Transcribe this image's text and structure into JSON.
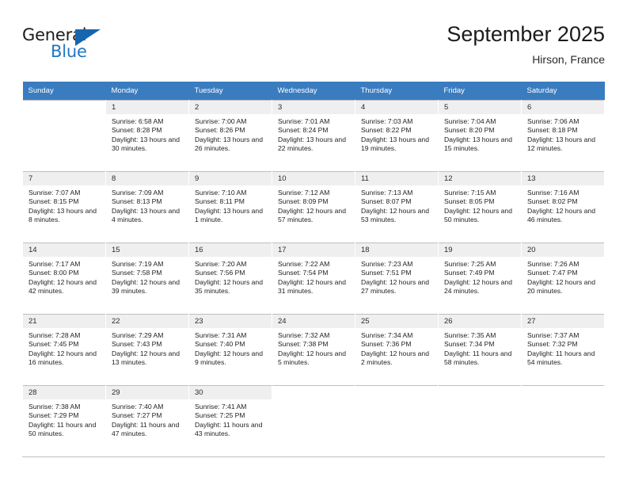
{
  "brand": {
    "name_top": "General",
    "name_bottom": "Blue",
    "triangle_icon": "triangle-icon",
    "color_dark": "#1b1b1b",
    "color_blue": "#2077c4",
    "color_triangle": "#1566ae"
  },
  "header": {
    "title": "September 2025",
    "subtitle": "Hirson, France"
  },
  "colors": {
    "header_row": "#3a7cc0",
    "header_text": "#ffffff",
    "daynum_band": "#efefef",
    "grid_line": "#bfbfbf"
  },
  "weekday_headers": [
    "Sunday",
    "Monday",
    "Tuesday",
    "Wednesday",
    "Thursday",
    "Friday",
    "Saturday"
  ],
  "weeks": [
    [
      {
        "day": "",
        "sunrise": "",
        "sunset": "",
        "daylight": "",
        "empty": true
      },
      {
        "day": "1",
        "sunrise": "Sunrise: 6:58 AM",
        "sunset": "Sunset: 8:28 PM",
        "daylight": "Daylight: 13 hours and 30 minutes."
      },
      {
        "day": "2",
        "sunrise": "Sunrise: 7:00 AM",
        "sunset": "Sunset: 8:26 PM",
        "daylight": "Daylight: 13 hours and 26 minutes."
      },
      {
        "day": "3",
        "sunrise": "Sunrise: 7:01 AM",
        "sunset": "Sunset: 8:24 PM",
        "daylight": "Daylight: 13 hours and 22 minutes."
      },
      {
        "day": "4",
        "sunrise": "Sunrise: 7:03 AM",
        "sunset": "Sunset: 8:22 PM",
        "daylight": "Daylight: 13 hours and 19 minutes."
      },
      {
        "day": "5",
        "sunrise": "Sunrise: 7:04 AM",
        "sunset": "Sunset: 8:20 PM",
        "daylight": "Daylight: 13 hours and 15 minutes."
      },
      {
        "day": "6",
        "sunrise": "Sunrise: 7:06 AM",
        "sunset": "Sunset: 8:18 PM",
        "daylight": "Daylight: 13 hours and 12 minutes."
      }
    ],
    [
      {
        "day": "7",
        "sunrise": "Sunrise: 7:07 AM",
        "sunset": "Sunset: 8:15 PM",
        "daylight": "Daylight: 13 hours and 8 minutes."
      },
      {
        "day": "8",
        "sunrise": "Sunrise: 7:09 AM",
        "sunset": "Sunset: 8:13 PM",
        "daylight": "Daylight: 13 hours and 4 minutes."
      },
      {
        "day": "9",
        "sunrise": "Sunrise: 7:10 AM",
        "sunset": "Sunset: 8:11 PM",
        "daylight": "Daylight: 13 hours and 1 minute."
      },
      {
        "day": "10",
        "sunrise": "Sunrise: 7:12 AM",
        "sunset": "Sunset: 8:09 PM",
        "daylight": "Daylight: 12 hours and 57 minutes."
      },
      {
        "day": "11",
        "sunrise": "Sunrise: 7:13 AM",
        "sunset": "Sunset: 8:07 PM",
        "daylight": "Daylight: 12 hours and 53 minutes."
      },
      {
        "day": "12",
        "sunrise": "Sunrise: 7:15 AM",
        "sunset": "Sunset: 8:05 PM",
        "daylight": "Daylight: 12 hours and 50 minutes."
      },
      {
        "day": "13",
        "sunrise": "Sunrise: 7:16 AM",
        "sunset": "Sunset: 8:02 PM",
        "daylight": "Daylight: 12 hours and 46 minutes."
      }
    ],
    [
      {
        "day": "14",
        "sunrise": "Sunrise: 7:17 AM",
        "sunset": "Sunset: 8:00 PM",
        "daylight": "Daylight: 12 hours and 42 minutes."
      },
      {
        "day": "15",
        "sunrise": "Sunrise: 7:19 AM",
        "sunset": "Sunset: 7:58 PM",
        "daylight": "Daylight: 12 hours and 39 minutes."
      },
      {
        "day": "16",
        "sunrise": "Sunrise: 7:20 AM",
        "sunset": "Sunset: 7:56 PM",
        "daylight": "Daylight: 12 hours and 35 minutes."
      },
      {
        "day": "17",
        "sunrise": "Sunrise: 7:22 AM",
        "sunset": "Sunset: 7:54 PM",
        "daylight": "Daylight: 12 hours and 31 minutes."
      },
      {
        "day": "18",
        "sunrise": "Sunrise: 7:23 AM",
        "sunset": "Sunset: 7:51 PM",
        "daylight": "Daylight: 12 hours and 27 minutes."
      },
      {
        "day": "19",
        "sunrise": "Sunrise: 7:25 AM",
        "sunset": "Sunset: 7:49 PM",
        "daylight": "Daylight: 12 hours and 24 minutes."
      },
      {
        "day": "20",
        "sunrise": "Sunrise: 7:26 AM",
        "sunset": "Sunset: 7:47 PM",
        "daylight": "Daylight: 12 hours and 20 minutes."
      }
    ],
    [
      {
        "day": "21",
        "sunrise": "Sunrise: 7:28 AM",
        "sunset": "Sunset: 7:45 PM",
        "daylight": "Daylight: 12 hours and 16 minutes."
      },
      {
        "day": "22",
        "sunrise": "Sunrise: 7:29 AM",
        "sunset": "Sunset: 7:43 PM",
        "daylight": "Daylight: 12 hours and 13 minutes."
      },
      {
        "day": "23",
        "sunrise": "Sunrise: 7:31 AM",
        "sunset": "Sunset: 7:40 PM",
        "daylight": "Daylight: 12 hours and 9 minutes."
      },
      {
        "day": "24",
        "sunrise": "Sunrise: 7:32 AM",
        "sunset": "Sunset: 7:38 PM",
        "daylight": "Daylight: 12 hours and 5 minutes."
      },
      {
        "day": "25",
        "sunrise": "Sunrise: 7:34 AM",
        "sunset": "Sunset: 7:36 PM",
        "daylight": "Daylight: 12 hours and 2 minutes."
      },
      {
        "day": "26",
        "sunrise": "Sunrise: 7:35 AM",
        "sunset": "Sunset: 7:34 PM",
        "daylight": "Daylight: 11 hours and 58 minutes."
      },
      {
        "day": "27",
        "sunrise": "Sunrise: 7:37 AM",
        "sunset": "Sunset: 7:32 PM",
        "daylight": "Daylight: 11 hours and 54 minutes."
      }
    ],
    [
      {
        "day": "28",
        "sunrise": "Sunrise: 7:38 AM",
        "sunset": "Sunset: 7:29 PM",
        "daylight": "Daylight: 11 hours and 50 minutes."
      },
      {
        "day": "29",
        "sunrise": "Sunrise: 7:40 AM",
        "sunset": "Sunset: 7:27 PM",
        "daylight": "Daylight: 11 hours and 47 minutes."
      },
      {
        "day": "30",
        "sunrise": "Sunrise: 7:41 AM",
        "sunset": "Sunset: 7:25 PM",
        "daylight": "Daylight: 11 hours and 43 minutes."
      },
      {
        "day": "",
        "sunrise": "",
        "sunset": "",
        "daylight": "",
        "empty": true
      },
      {
        "day": "",
        "sunrise": "",
        "sunset": "",
        "daylight": "",
        "empty": true
      },
      {
        "day": "",
        "sunrise": "",
        "sunset": "",
        "daylight": "",
        "empty": true
      },
      {
        "day": "",
        "sunrise": "",
        "sunset": "",
        "daylight": "",
        "empty": true
      }
    ]
  ]
}
